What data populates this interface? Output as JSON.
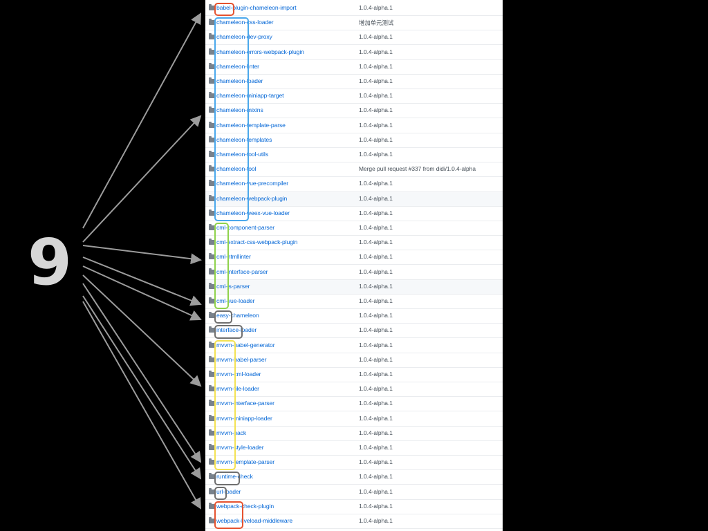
{
  "slide": {
    "number": "9"
  },
  "colors": {
    "red": "#e5522f",
    "blue": "#4aa8ec",
    "green": "#8fd24b",
    "gray": "#6f6f6f",
    "yellow": "#f3e253",
    "arrow": "#9c9c9c"
  },
  "rows": [
    {
      "prefix": "babel",
      "rest": "-plugin-chameleon-import",
      "msg": "1.0.4-alpha.1"
    },
    {
      "prefix": "chameleon",
      "rest": "-css-loader",
      "msg": "增加单元测试"
    },
    {
      "prefix": "chameleon",
      "rest": "-dev-proxy",
      "msg": "1.0.4-alpha.1"
    },
    {
      "prefix": "chameleon",
      "rest": "-errors-webpack-plugin",
      "msg": "1.0.4-alpha.1"
    },
    {
      "prefix": "chameleon",
      "rest": "-linter",
      "msg": "1.0.4-alpha.1"
    },
    {
      "prefix": "chameleon",
      "rest": "-loader",
      "msg": "1.0.4-alpha.1"
    },
    {
      "prefix": "chameleon",
      "rest": "-miniapp-target",
      "msg": "1.0.4-alpha.1"
    },
    {
      "prefix": "chameleon",
      "rest": "-mixins",
      "msg": "1.0.4-alpha.1"
    },
    {
      "prefix": "chameleon",
      "rest": "-template-parse",
      "msg": "1.0.4-alpha.1"
    },
    {
      "prefix": "chameleon",
      "rest": "-templates",
      "msg": "1.0.4-alpha.1"
    },
    {
      "prefix": "chameleon",
      "rest": "-tool-utils",
      "msg": "1.0.4-alpha.1"
    },
    {
      "prefix": "chameleon",
      "rest": "-tool",
      "msg": "Merge pull request #337 from didi/1.0.4-alpha"
    },
    {
      "prefix": "chameleon",
      "rest": "-vue-precompiler",
      "msg": "1.0.4-alpha.1"
    },
    {
      "prefix": "chameleon",
      "rest": "-webpack-plugin",
      "msg": "1.0.4-alpha.1"
    },
    {
      "prefix": "chameleon",
      "rest": "-weex-vue-loader",
      "msg": "1.0.4-alpha.1"
    },
    {
      "prefix": "cml",
      "rest": "-component-parser",
      "msg": "1.0.4-alpha.1"
    },
    {
      "prefix": "cml",
      "rest": "-extract-css-webpack-plugin",
      "msg": "1.0.4-alpha.1"
    },
    {
      "prefix": "cml",
      "rest": "-htmllinter",
      "msg": "1.0.4-alpha.1"
    },
    {
      "prefix": "cml",
      "rest": "-interface-parser",
      "msg": "1.0.4-alpha.1"
    },
    {
      "prefix": "cml",
      "rest": "-js-parser",
      "msg": "1.0.4-alpha.1"
    },
    {
      "prefix": "cml",
      "rest": "-vue-loader",
      "msg": "1.0.4-alpha.1"
    },
    {
      "prefix": "easy",
      "rest": "-chameleon",
      "msg": "1.0.4-alpha.1"
    },
    {
      "prefix": "interface",
      "rest": "-loader",
      "msg": "1.0.4-alpha.1"
    },
    {
      "prefix": "mvvm",
      "rest": "-babel-generator",
      "msg": "1.0.4-alpha.1"
    },
    {
      "prefix": "mvvm",
      "rest": "-babel-parser",
      "msg": "1.0.4-alpha.1"
    },
    {
      "prefix": "mvvm",
      "rest": "-cml-loader",
      "msg": "1.0.4-alpha.1"
    },
    {
      "prefix": "mvvm",
      "rest": "-file-loader",
      "msg": "1.0.4-alpha.1"
    },
    {
      "prefix": "mvvm",
      "rest": "-interface-parser",
      "msg": "1.0.4-alpha.1"
    },
    {
      "prefix": "mvvm",
      "rest": "-miniapp-loader",
      "msg": "1.0.4-alpha.1"
    },
    {
      "prefix": "mvvm",
      "rest": "-pack",
      "msg": "1.0.4-alpha.1"
    },
    {
      "prefix": "mvvm",
      "rest": "-style-loader",
      "msg": "1.0.4-alpha.1"
    },
    {
      "prefix": "mvvm",
      "rest": "-template-parser",
      "msg": "1.0.4-alpha.1"
    },
    {
      "prefix": "runtime",
      "rest": "-check",
      "msg": "1.0.4-alpha.1"
    },
    {
      "prefix": "url",
      "rest": "-loader",
      "msg": "1.0.4-alpha.1"
    },
    {
      "prefix": "webpack",
      "rest": "-check-plugin",
      "msg": "1.0.4-alpha.1"
    },
    {
      "prefix": "webpack",
      "rest": "-liveload-middleware",
      "msg": "1.0.4-alpha.1"
    }
  ],
  "groups": [
    {
      "name": "babel",
      "color": "red"
    },
    {
      "name": "chameleon",
      "color": "blue"
    },
    {
      "name": "cml",
      "color": "green"
    },
    {
      "name": "easy",
      "color": "gray"
    },
    {
      "name": "interface",
      "color": "gray"
    },
    {
      "name": "mvvm",
      "color": "yellow"
    },
    {
      "name": "runtime",
      "color": "gray"
    },
    {
      "name": "url",
      "color": "gray"
    },
    {
      "name": "webpack",
      "color": "red"
    }
  ]
}
